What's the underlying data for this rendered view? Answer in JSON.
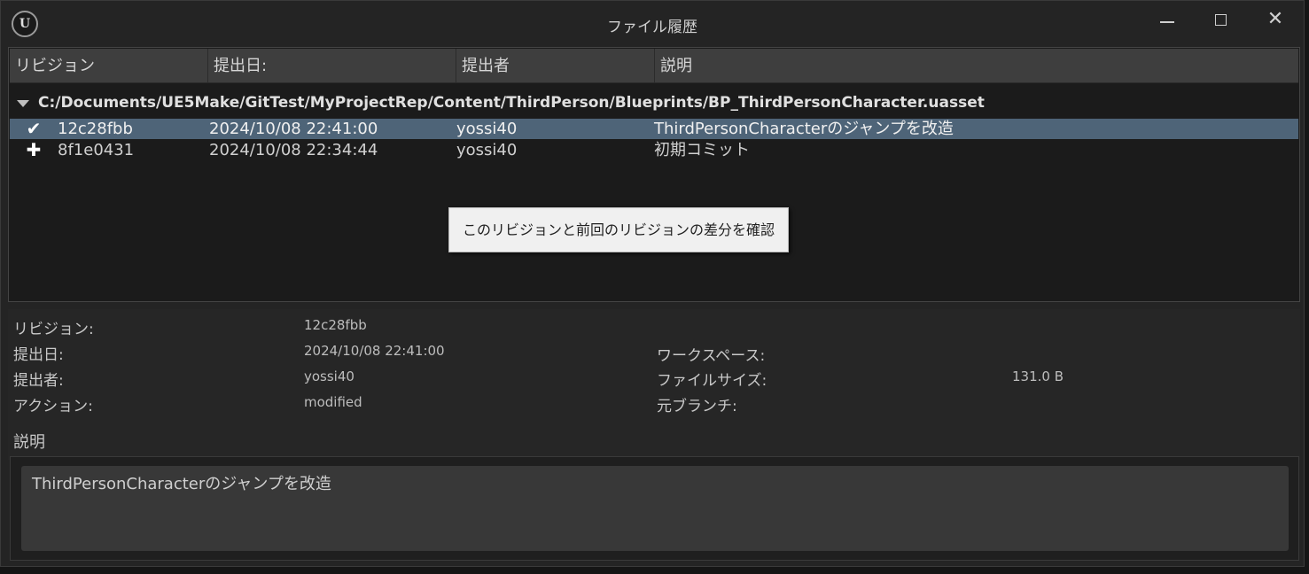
{
  "window": {
    "title": "ファイル履歴",
    "logo": "U",
    "close_glyph": "✕"
  },
  "columns": [
    "リビジョン",
    "提出日:",
    "提出者",
    "説明"
  ],
  "group": {
    "path": "C:/Documents/UE5Make/GitTest/MyProjectRep/Content/ThirdPerson/Blueprints/BP_ThirdPersonCharacter.uasset",
    "expanded": true
  },
  "rows": [
    {
      "icon": "checkmark-icon",
      "glyph": "✔",
      "revision": "12c28fbb",
      "date": "2024/10/08 22:41:00",
      "user": "yossi40",
      "description": "ThirdPersonCharacterのジャンプを改造",
      "selected": true
    },
    {
      "icon": "plus-icon",
      "glyph": "✚",
      "revision": "8f1e0431",
      "date": "2024/10/08 22:34:44",
      "user": "yossi40",
      "description": "初期コミット",
      "selected": false
    }
  ],
  "context_menu": {
    "diff_label": "このリビジョンと前回のリビジョンの差分を確認"
  },
  "details": {
    "revision_label": "リビジョン:",
    "revision_value": "12c28fbb",
    "date_label": "提出日:",
    "date_value": "2024/10/08 22:41:00",
    "user_label": "提出者:",
    "user_value": "yossi40",
    "action_label": "アクション:",
    "action_value": "modified",
    "workspace_label": "ワークスペース:",
    "workspace_value": "",
    "filesize_label": "ファイルサイズ:",
    "filesize_value": "131.0 B",
    "branch_label": "元ブランチ:",
    "branch_value": ""
  },
  "description": {
    "label": "説明",
    "text": "ThirdPersonCharacterのジャンプを改造"
  },
  "colors": {
    "selected_row": "#4e6478",
    "background": "#242424",
    "header": "#3e3e3e"
  }
}
